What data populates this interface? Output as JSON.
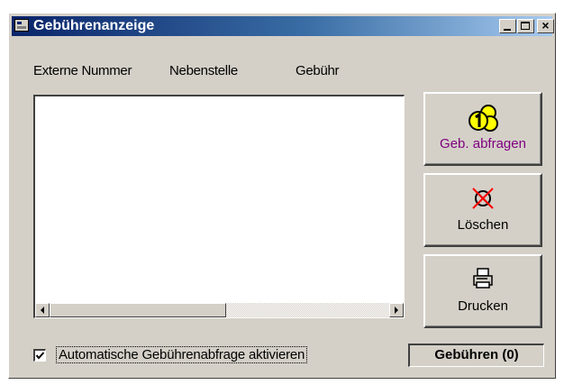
{
  "window": {
    "title": "Gebührenanzeige"
  },
  "list": {
    "columns": [
      "Externe Nummer",
      "Nebenstelle",
      "Gebühr"
    ],
    "rows": []
  },
  "buttons": {
    "query": {
      "label": "Geb. abfragen",
      "icon": "coins-icon",
      "label_color": "#800080"
    },
    "delete": {
      "label": "Löschen",
      "icon": "delete-x-icon"
    },
    "print": {
      "label": "Drucken",
      "icon": "printer-icon"
    }
  },
  "checkbox": {
    "label": "Automatische Gebührenabfrage aktivieren",
    "checked": true
  },
  "fee_display": {
    "text": "Gebühren (0)"
  },
  "colors": {
    "titlebar_start": "#0a246a",
    "titlebar_end": "#a6caf0",
    "face": "#d4d0c8",
    "delete_x": "#ff0000",
    "coin": "#ffff00"
  }
}
